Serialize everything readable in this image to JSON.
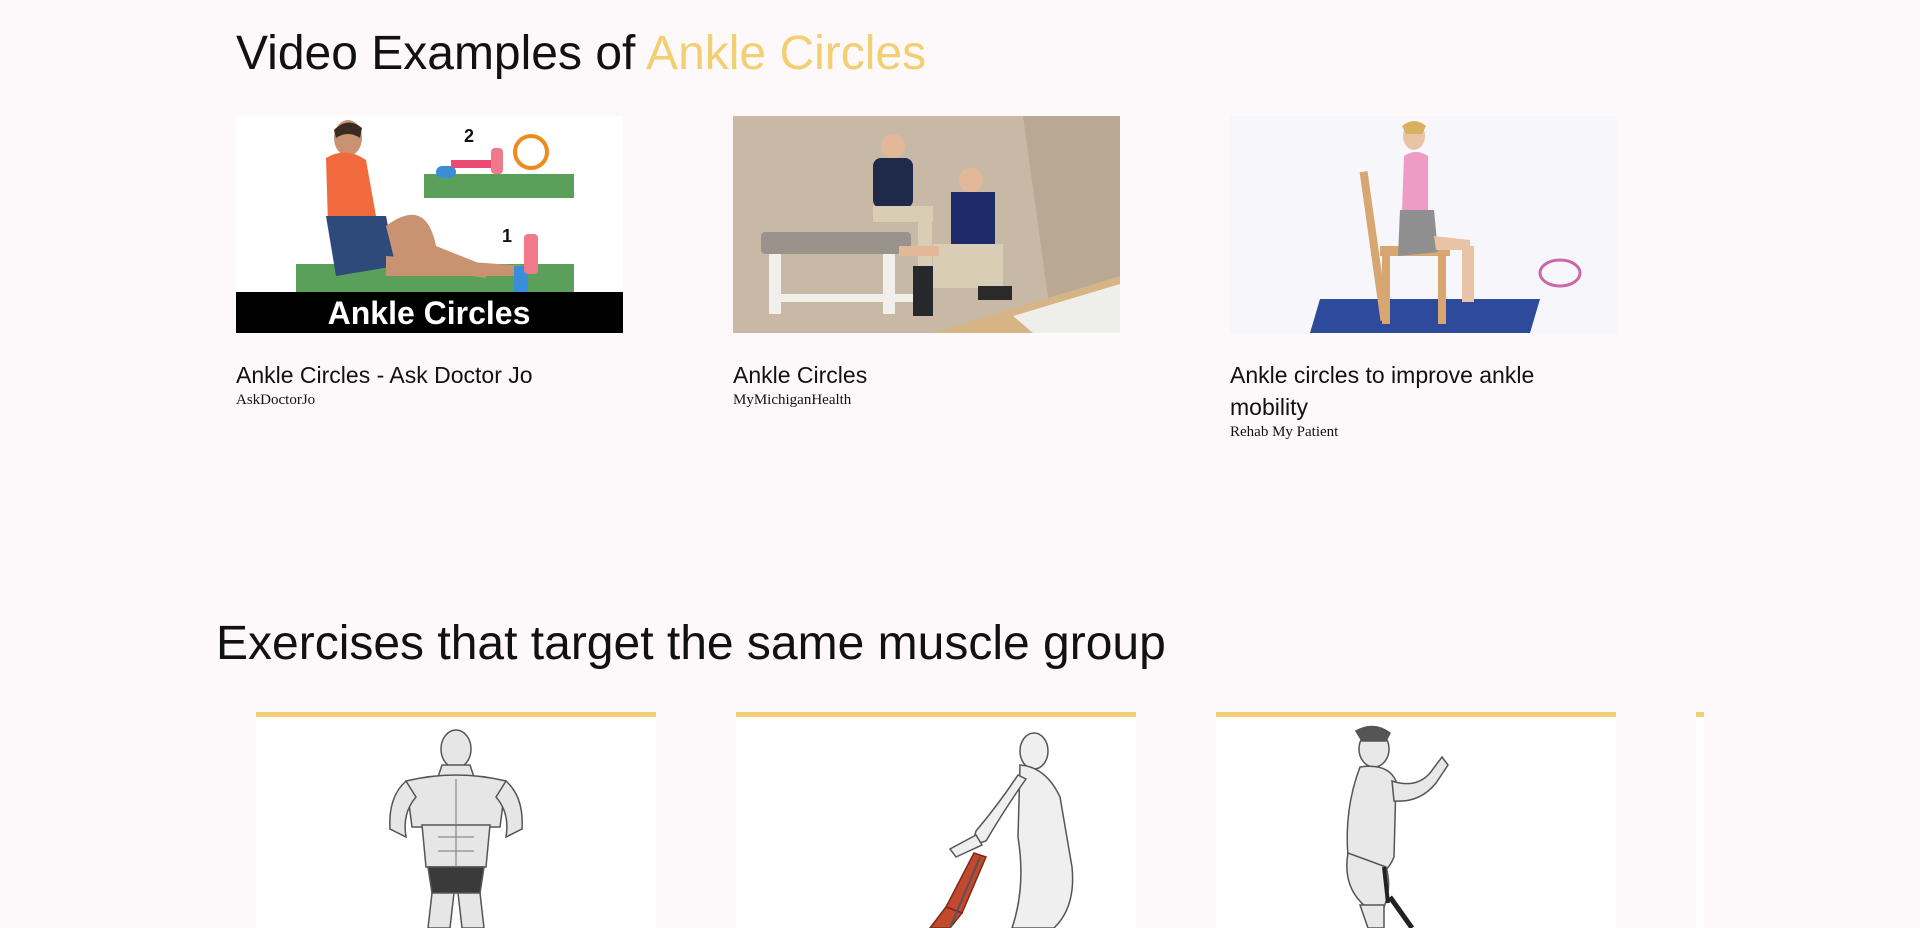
{
  "video_section": {
    "heading_prefix": "Video Examples of ",
    "heading_accent": "Ankle Circles",
    "accent_color": "#f3cf73",
    "videos": [
      {
        "title": "Ankle Circles - Ask Doctor Jo",
        "channel": "AskDoctorJo",
        "thumb_caption": "Ankle Circles",
        "step_labels": [
          "2",
          "1"
        ]
      },
      {
        "title": "Ankle Circles",
        "channel": "MyMichiganHealth"
      },
      {
        "title": "Ankle circles to improve ankle mobility",
        "channel": "Rehab My Patient"
      }
    ]
  },
  "exercises_section": {
    "heading": "Exercises that target the same muscle group"
  }
}
